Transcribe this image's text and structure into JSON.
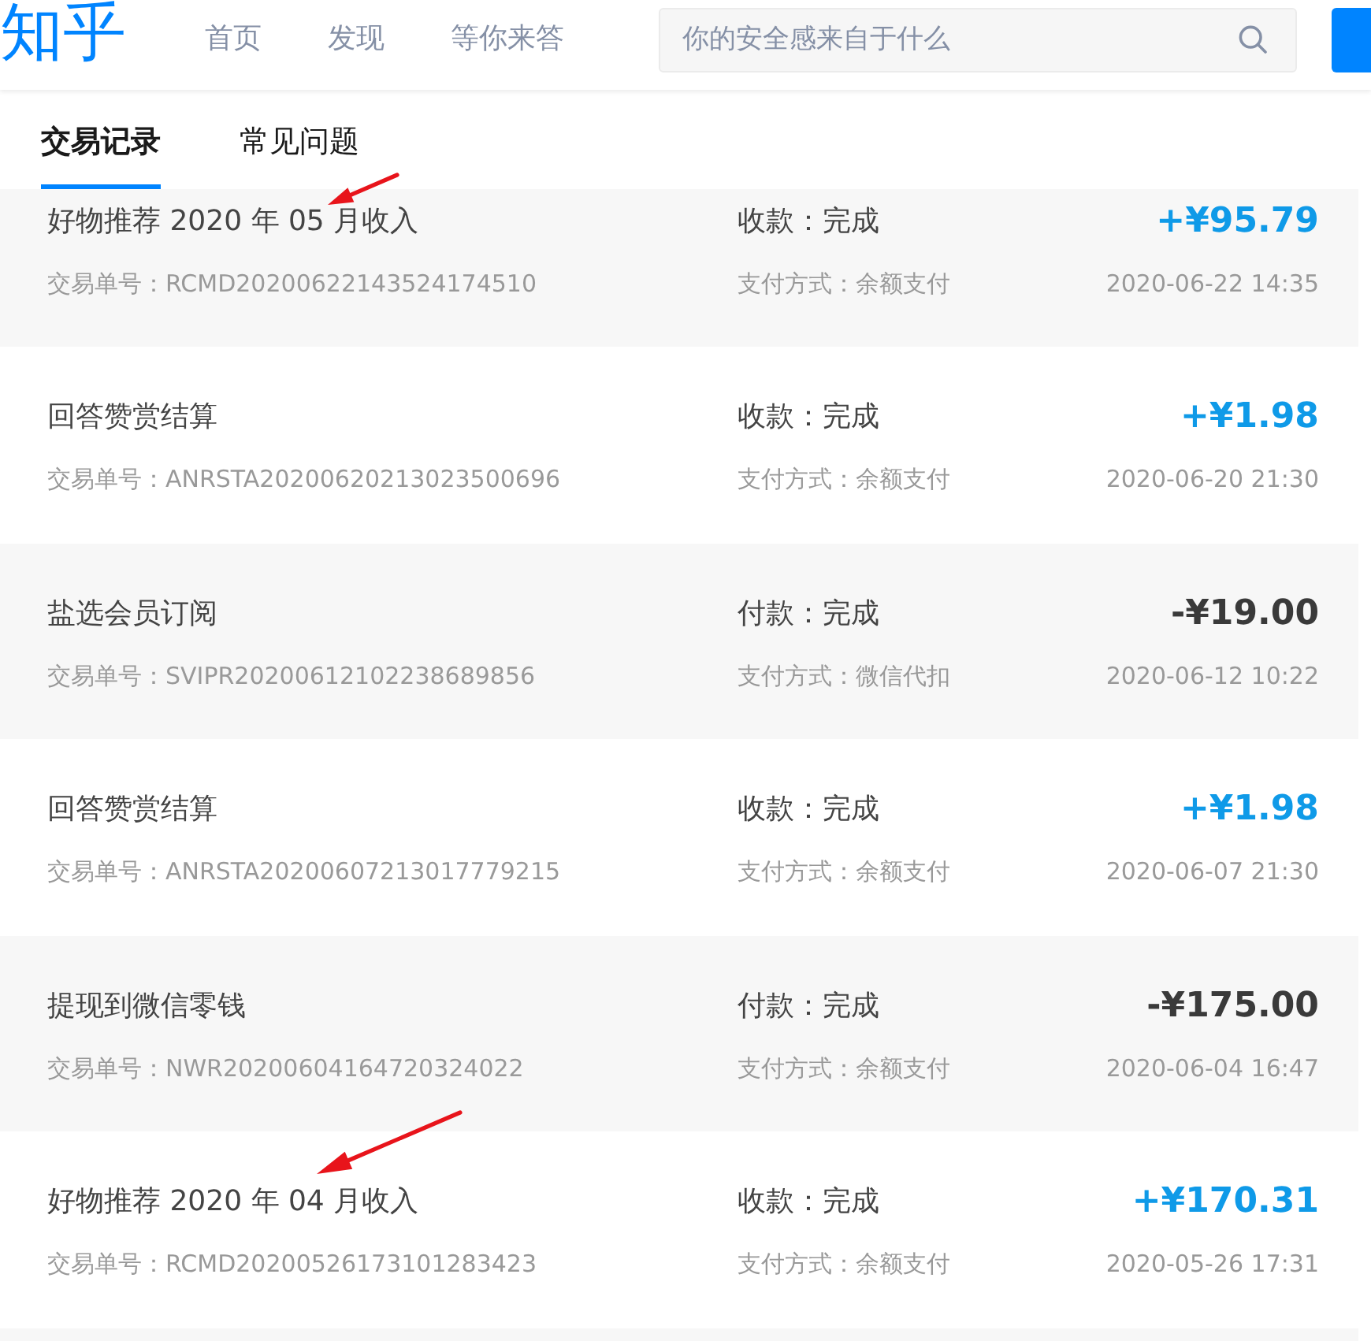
{
  "header": {
    "logo": "知乎",
    "nav": [
      {
        "label": "首页"
      },
      {
        "label": "发现"
      },
      {
        "label": "等你来答"
      }
    ],
    "search": {
      "placeholder": "你的安全感来自于什么"
    }
  },
  "tabs": [
    {
      "label": "交易记录",
      "selected": true
    },
    {
      "label": "常见问题",
      "selected": false
    }
  ],
  "transactions": [
    {
      "title": "好物推荐 2020 年 05 月收入",
      "status": "收款：完成",
      "amount": "+¥95.79",
      "income": true,
      "order_no": "交易单号：RCMD20200622143524174510",
      "payment": "支付方式：余额支付",
      "time": "2020-06-22 14:35",
      "arrow_marked": true
    },
    {
      "title": "回答赞赏结算",
      "status": "收款：完成",
      "amount": "+¥1.98",
      "income": true,
      "order_no": "交易单号：ANRSTA20200620213023500696",
      "payment": "支付方式：余额支付",
      "time": "2020-06-20 21:30",
      "arrow_marked": false
    },
    {
      "title": "盐选会员订阅",
      "status": "付款：完成",
      "amount": "-¥19.00",
      "income": false,
      "order_no": "交易单号：SVIPR20200612102238689856",
      "payment": "支付方式：微信代扣",
      "time": "2020-06-12 10:22",
      "arrow_marked": false
    },
    {
      "title": "回答赞赏结算",
      "status": "收款：完成",
      "amount": "+¥1.98",
      "income": true,
      "order_no": "交易单号：ANRSTA20200607213017779215",
      "payment": "支付方式：余额支付",
      "time": "2020-06-07 21:30",
      "arrow_marked": false
    },
    {
      "title": "提现到微信零钱",
      "status": "付款：完成",
      "amount": "-¥175.00",
      "income": false,
      "order_no": "交易单号：NWR20200604164720324022",
      "payment": "支付方式：余额支付",
      "time": "2020-06-04 16:47",
      "arrow_marked": false
    },
    {
      "title": "好物推荐 2020 年 04 月收入",
      "status": "收款：完成",
      "amount": "+¥170.31",
      "income": true,
      "order_no": "交易单号：RCMD20200526173101283423",
      "payment": "支付方式：余额支付",
      "time": "2020-05-26 17:31",
      "arrow_marked": true
    }
  ]
}
